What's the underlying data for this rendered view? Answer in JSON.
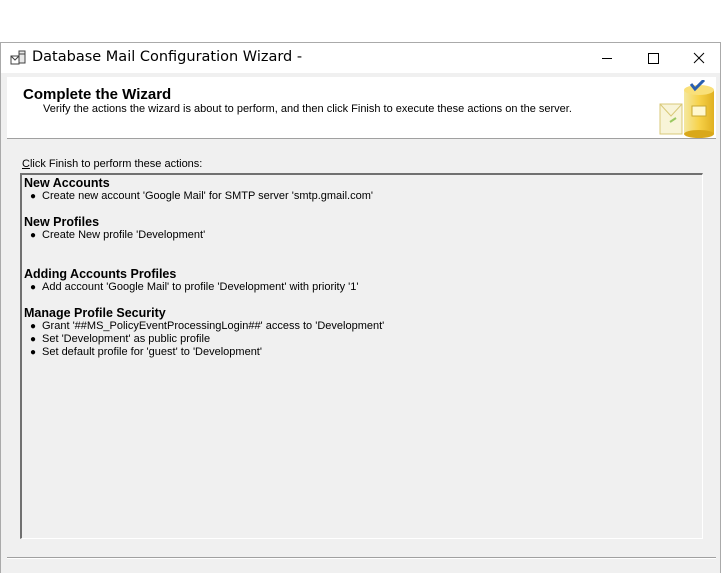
{
  "window": {
    "title": "Database Mail Configuration Wizard -",
    "icon": "database-mail-icon"
  },
  "header": {
    "title": "Complete the Wizard",
    "subtitle": "Verify the actions the wizard is about to perform, and then click Finish to execute these actions on the server.",
    "graphic": "wizard-checkmark-graphic"
  },
  "actions": {
    "label_accel": "C",
    "label_rest": "lick Finish to perform these actions:",
    "groups": [
      {
        "heading": "New Accounts",
        "items": [
          "Create new account 'Google Mail' for SMTP server 'smtp.gmail.com'"
        ]
      },
      {
        "heading": "New Profiles",
        "items": [
          "Create New profile 'Development'"
        ]
      },
      {
        "heading": "Adding Accounts Profiles",
        "items": [
          "Add account 'Google Mail' to profile 'Development' with priority '1'"
        ]
      },
      {
        "heading": "Manage Profile Security",
        "items": [
          "Grant '##MS_PolicyEventProcessingLogin##' access to 'Development'",
          "Set 'Development' as public profile",
          "Set default profile for 'guest' to 'Development'"
        ]
      }
    ]
  },
  "colors": {
    "window_bg": "#f0f0f0",
    "titlebar_bg": "#ffffff",
    "header_bg": "#ffffff",
    "accent_check": "#2a5fb0"
  }
}
